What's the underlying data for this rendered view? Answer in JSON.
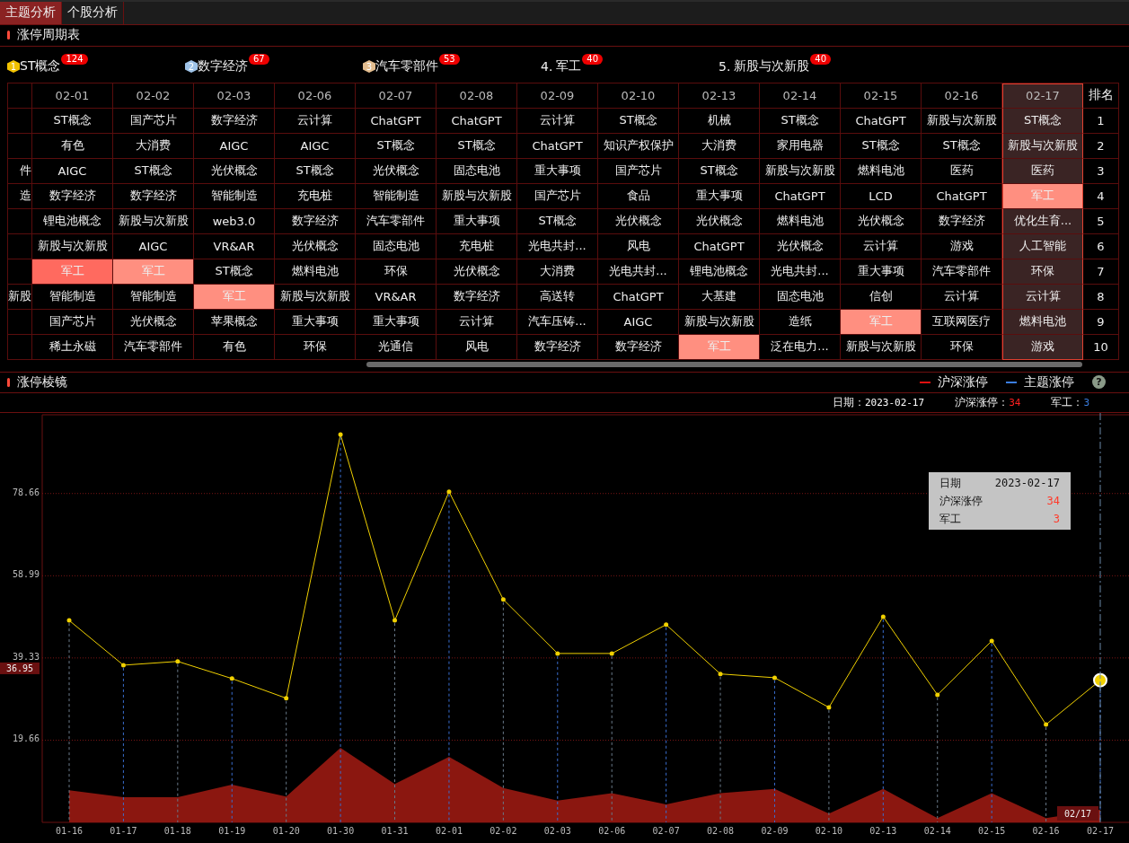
{
  "tabs": [
    {
      "label": "主题分析",
      "selected": true
    },
    {
      "label": "个股分析",
      "selected": false
    }
  ],
  "cycle_section": {
    "title": "涨停周期表",
    "themes": [
      {
        "kind": "medal",
        "rank": "1",
        "name": "ST概念",
        "count": "124",
        "color": "#f2c200"
      },
      {
        "kind": "medal",
        "rank": "2",
        "name": "数字经济",
        "count": "67",
        "color": "#9fc3e8"
      },
      {
        "kind": "medal",
        "rank": "3",
        "name": "汽车零部件",
        "count": "53",
        "color": "#e3bd8e"
      },
      {
        "kind": "plain",
        "rank": "4.",
        "name": "军工",
        "count": "40"
      },
      {
        "kind": "plain",
        "rank": "5.",
        "name": "新股与次新股",
        "count": "40"
      }
    ],
    "table": {
      "columns": [
        {
          "label": "02-01",
          "selected": false
        },
        {
          "label": "02-02",
          "selected": false
        },
        {
          "label": "02-03",
          "selected": false
        },
        {
          "label": "02-06",
          "selected": false
        },
        {
          "label": "02-07",
          "selected": false
        },
        {
          "label": "02-08",
          "selected": false
        },
        {
          "label": "02-09",
          "selected": false
        },
        {
          "label": "02-10",
          "selected": false
        },
        {
          "label": "02-13",
          "selected": false
        },
        {
          "label": "02-14",
          "selected": false
        },
        {
          "label": "02-15",
          "selected": false
        },
        {
          "label": "02-16",
          "selected": false
        },
        {
          "label": "02-17",
          "selected": true
        }
      ],
      "rank_header": "排名",
      "rows": [
        {
          "cells": [
            "ST概念",
            "国产芯片",
            "数字经济",
            "云计算",
            "ChatGPT",
            "ChatGPT",
            "云计算",
            "ST概念",
            "机械",
            "ST概念",
            "ChatGPT",
            "新股与次新股",
            "ST概念"
          ],
          "rank": "1"
        },
        {
          "cells": [
            "有色",
            "大消费",
            "AIGC",
            "AIGC",
            "ST概念",
            "ST概念",
            "ChatGPT",
            "知识产权保护",
            "大消费",
            "家用电器",
            "ST概念",
            "ST概念",
            "新股与次新股"
          ],
          "rank": "2"
        },
        {
          "cut": "件",
          "cells": [
            "AIGC",
            "ST概念",
            "光伏概念",
            "ST概念",
            "光伏概念",
            "固态电池",
            "重大事项",
            "国产芯片",
            "ST概念",
            "新股与次新股",
            "燃料电池",
            "医药",
            "医药"
          ],
          "rank": "3"
        },
        {
          "cut": "造",
          "cells": [
            "数字经济",
            "数字经济",
            "智能制造",
            "充电桩",
            "智能制造",
            "新股与次新股",
            "国产芯片",
            "食品",
            "重大事项",
            "ChatGPT",
            "LCD",
            "ChatGPT",
            {
              "text": "军工",
              "color": "#ff8f80"
            }
          ],
          "rank": "4"
        },
        {
          "cells": [
            "锂电池概念",
            "新股与次新股",
            "web3.0",
            "数字经济",
            "汽车零部件",
            "重大事项",
            "ST概念",
            "光伏概念",
            "光伏概念",
            "燃料电池",
            "光伏概念",
            "数字经济",
            "优化生育..."
          ],
          "rank": "5"
        },
        {
          "cells": [
            "新股与次新股",
            "AIGC",
            "VR&AR",
            "光伏概念",
            "固态电池",
            "充电桩",
            "光电共封...",
            "风电",
            "ChatGPT",
            "光伏概念",
            "云计算",
            "游戏",
            "人工智能"
          ],
          "rank": "6"
        },
        {
          "cells": [
            {
              "text": "军工",
              "color": "#ff6a5f"
            },
            {
              "text": "军工",
              "color": "#ff8f80"
            },
            "ST概念",
            "燃料电池",
            "环保",
            "光伏概念",
            "大消费",
            "光电共封...",
            "锂电池概念",
            "光电共封...",
            "重大事项",
            "汽车零部件",
            "环保"
          ],
          "rank": "7"
        },
        {
          "cut": "新股",
          "cells": [
            "智能制造",
            "智能制造",
            {
              "text": "军工",
              "color": "#ff8f80"
            },
            "新股与次新股",
            "VR&AR",
            "数字经济",
            "高送转",
            "ChatGPT",
            "大基建",
            "固态电池",
            "信创",
            "云计算",
            "云计算"
          ],
          "rank": "8"
        },
        {
          "cells": [
            "国产芯片",
            "光伏概念",
            "苹果概念",
            "重大事项",
            "重大事项",
            "云计算",
            "汽车压铸...",
            "AIGC",
            "新股与次新股",
            "造纸",
            {
              "text": "军工",
              "color": "#ff8f80"
            },
            "互联网医疗",
            "燃料电池"
          ],
          "rank": "9"
        },
        {
          "cells": [
            "稀土永磁",
            "汽车零部件",
            "有色",
            "环保",
            "光通信",
            "风电",
            "数字经济",
            "数字经济",
            {
              "text": "军工",
              "color": "#ff8f80"
            },
            "泛在电力...",
            "新股与次新股",
            "环保",
            "游戏"
          ],
          "rank": "10"
        }
      ]
    }
  },
  "prism_section": {
    "title": "涨停棱镜",
    "legend": [
      {
        "label": "沪深涨停",
        "color": "#e01010"
      },
      {
        "label": "主题涨停",
        "color": "#3a7ee0"
      }
    ],
    "help": "?",
    "info": [
      {
        "label": "日期：",
        "value": "2023-02-17",
        "color": "#ffffff"
      },
      {
        "label": "沪深涨停：",
        "value": "34",
        "color": "#ff2020"
      },
      {
        "label": "军工：",
        "value": "3",
        "color": "#3a7ee0"
      }
    ],
    "tooltip": {
      "date_label": "日期",
      "date": "2023-02-17",
      "values": [
        "34",
        "3"
      ]
    },
    "cursor": {
      "y_label": "36.95",
      "x_label": "02/17"
    },
    "chart_data": {
      "type": "line",
      "categories": [
        "01-16",
        "01-17",
        "01-18",
        "01-19",
        "01-20",
        "01-30",
        "01-31",
        "02-01",
        "02-02",
        "02-03",
        "02-06",
        "02-07",
        "02-08",
        "02-09",
        "02-10",
        "02-13",
        "02-14",
        "02-15",
        "02-16",
        "02-17"
      ],
      "ylim": [
        0,
        97.5
      ],
      "grid": true,
      "yticks": [
        19.66,
        39.33,
        58.99,
        78.66
      ],
      "series": [
        {
          "name": "沪深涨停",
          "type": "line",
          "color": "#f0d000",
          "values": [
            48.3,
            37.6,
            38.5,
            34.4,
            29.7,
            92.8,
            48.3,
            79.1,
            53.3,
            40.4,
            40.4,
            47.3,
            35.5,
            34.6,
            27.5,
            49.2,
            30.5,
            43.4,
            23.4,
            34
          ]
        },
        {
          "name": "军工",
          "type": "area",
          "color": "#8b1710",
          "values": [
            7.7,
            6,
            6,
            9,
            6.2,
            17.8,
            9.2,
            15.7,
            8.2,
            5.2,
            7,
            4.3,
            7,
            8,
            2.1,
            8,
            1,
            7,
            1,
            3
          ]
        }
      ]
    }
  }
}
